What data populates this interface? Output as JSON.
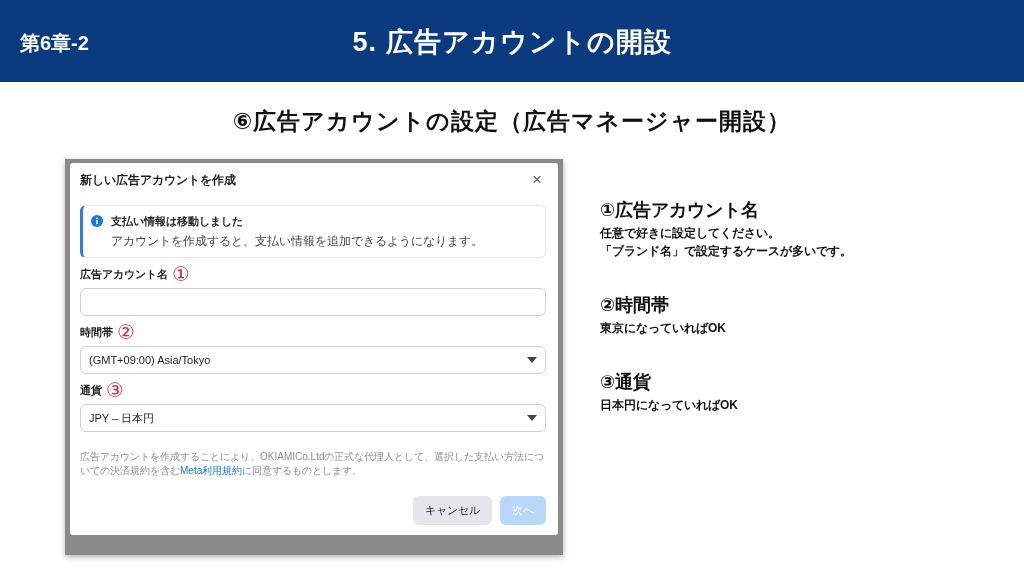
{
  "header": {
    "chapter": "第6章-2",
    "title": "5. 広告アカウントの開設"
  },
  "subtitle": "⑥広告アカウントの設定（広告マネージャー開設）",
  "dialog": {
    "title": "新しい広告アカウントを作成",
    "close": "×",
    "notice": {
      "title": "支払い情報は移動しました",
      "text": "アカウントを作成すると、支払い情報を追加できるようになります。"
    },
    "fields": [
      {
        "kind": "text",
        "label": "広告アカウント名",
        "marker": "①"
      },
      {
        "kind": "select",
        "label": "時間帯",
        "marker": "②",
        "value": "(GMT+09:00) Asia/Tokyo"
      },
      {
        "kind": "select",
        "label": "通貨",
        "marker": "③",
        "value": "JPY – 日本円"
      }
    ],
    "terms": {
      "before": "広告アカウントを作成することにより、OKIAMICo.Ltdの正式な代理人として、選択した支払い方法についての決済規約を含む",
      "link": "Meta利用規約",
      "after": "に同意するものとします。"
    },
    "buttons": [
      {
        "label": "キャンセル",
        "kind": "secondary",
        "disabled": false
      },
      {
        "label": "次へ",
        "kind": "primary",
        "disabled": true
      }
    ]
  },
  "notes": [
    {
      "heading": "①広告アカウント名",
      "lines": [
        "任意で好きに設定してください。",
        "「ブランド名」で設定するケースが多いです。"
      ]
    },
    {
      "heading": "②時間帯",
      "lines": [
        "東京になっていればOK"
      ]
    },
    {
      "heading": "③通貨",
      "lines": [
        "日本円になっていればOK"
      ]
    }
  ]
}
